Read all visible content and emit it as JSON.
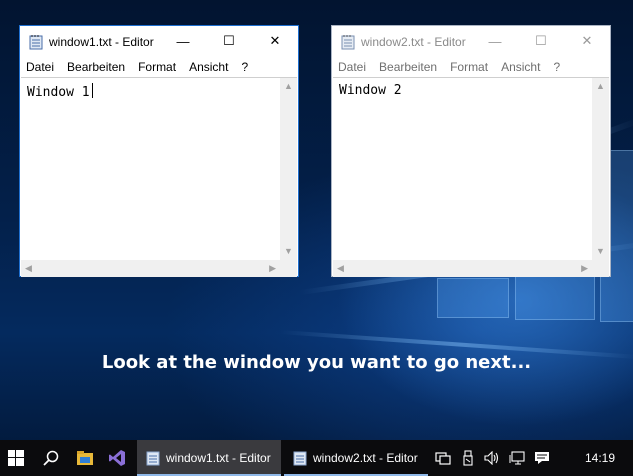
{
  "windows": [
    {
      "title": "window1.txt - Editor",
      "active": true,
      "menu": [
        "Datei",
        "Bearbeiten",
        "Format",
        "Ansicht",
        "?"
      ],
      "content": "Window 1",
      "caption": {
        "minimize": "—",
        "maximize": "☐",
        "close": "✕"
      }
    },
    {
      "title": "window2.txt - Editor",
      "active": false,
      "menu": [
        "Datei",
        "Bearbeiten",
        "Format",
        "Ansicht",
        "?"
      ],
      "content": "Window 2",
      "caption": {
        "minimize": "—",
        "maximize": "☐",
        "close": "✕"
      }
    }
  ],
  "overlay_prompt": "Look at the window you want to go next...",
  "taskbar": {
    "tasks": [
      {
        "label": "window1.txt - Editor",
        "active": true
      },
      {
        "label": "window2.txt - Editor",
        "active": false
      }
    ],
    "clock": "14:19",
    "icons": [
      "windows-start-icon",
      "search-icon",
      "file-explorer-icon",
      "visual-studio-icon",
      "task-view-icon",
      "usb-icon",
      "volume-icon",
      "network-icon",
      "notification-icon"
    ]
  },
  "colors": {
    "active_border": "#1e6fd0",
    "taskbar": "#0b0b0d",
    "desktop": "#03204a"
  }
}
